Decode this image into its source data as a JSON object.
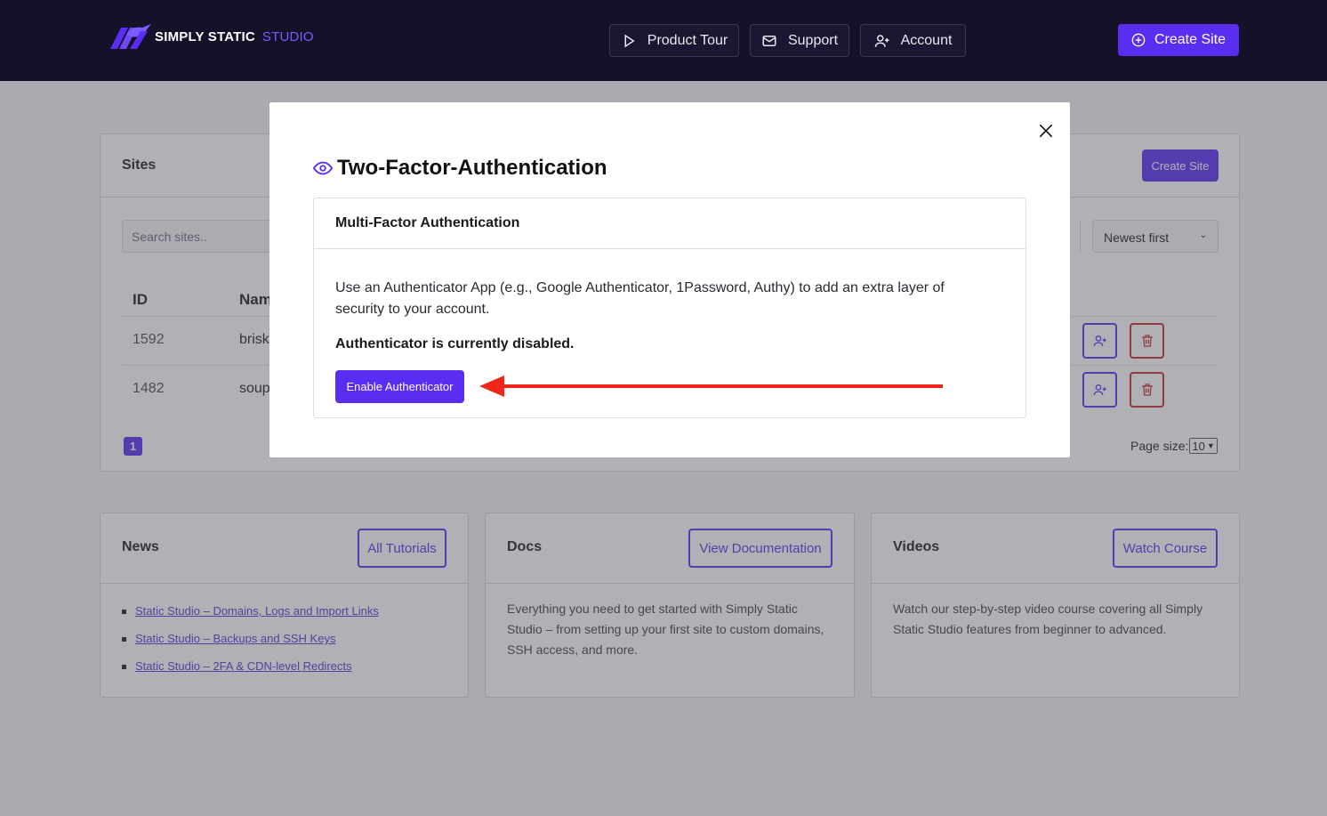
{
  "header": {
    "brand_main": "SIMPLY STATIC",
    "brand_accent": "STUDIO",
    "nav": [
      {
        "label": "Product Tour",
        "icon": "play-icon"
      },
      {
        "label": "Support",
        "icon": "mail-icon"
      },
      {
        "label": "Account",
        "icon": "user-plus-icon"
      }
    ],
    "create_site_label": "Create Site"
  },
  "sites": {
    "title": "Sites",
    "create_site_label": "Create Site",
    "search_placeholder": "Search sites..",
    "sort_selected": "Newest first",
    "columns": {
      "id": "ID",
      "name": "Nam"
    },
    "rows": [
      {
        "id": "1592",
        "name": "brisk"
      },
      {
        "id": "1482",
        "name": "soup"
      }
    ],
    "current_page": "1",
    "page_size_label": "Page size:",
    "page_size_value": "10"
  },
  "news": {
    "title": "News",
    "button_label": "All Tutorials",
    "links": [
      "Static Studio – Domains, Logs and Import Links",
      "Static Studio – Backups and SSH Keys",
      "Static Studio – 2FA & CDN-level Redirects"
    ]
  },
  "docs": {
    "title": "Docs",
    "button_label": "View Documentation",
    "text": "Everything you need to get started with Simply Static Studio – from setting up your first site to custom domains, SSH access, and more."
  },
  "videos": {
    "title": "Videos",
    "button_label": "Watch Course",
    "text": "Watch our step-by-step video course covering all Simply Static Studio features from beginner to advanced."
  },
  "modal": {
    "title": "Two-Factor-Authentication",
    "section_title": "Multi-Factor Authentication",
    "description": "Use an Authenticator App (e.g., Google Authenticator, 1Password, Authy) to add an extra layer of security to your account.",
    "status": "Authenticator is currently disabled.",
    "enable_label": "Enable Authenticator"
  },
  "colors": {
    "accent": "#5a2df2",
    "header_bg": "#151129",
    "danger": "#c22d2d",
    "annotation_arrow": "#f0261b"
  }
}
